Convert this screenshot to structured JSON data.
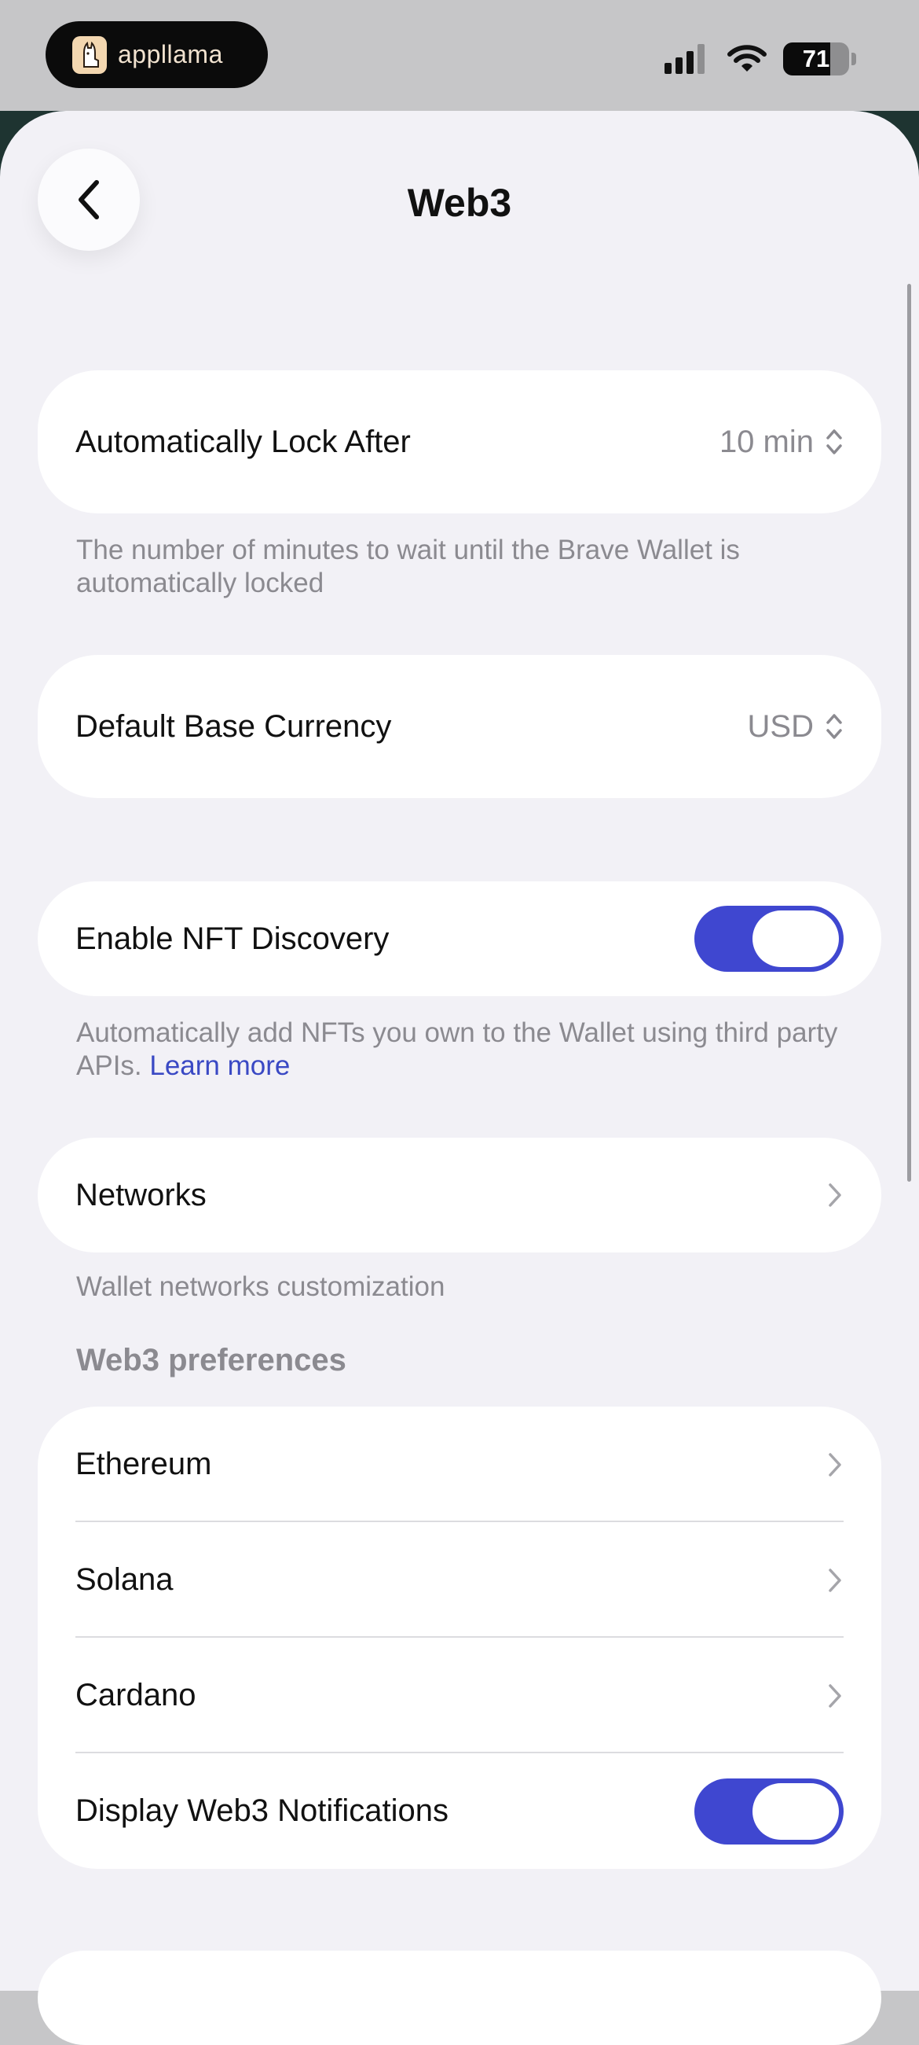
{
  "status_bar": {
    "app_name": "appllama",
    "battery_percent": "71",
    "battery_level": 0.71,
    "icons": [
      "signal-icon",
      "wifi-icon",
      "battery-icon"
    ]
  },
  "header": {
    "title": "Web3",
    "back_icon": "chevron-left-icon"
  },
  "auto_lock": {
    "label": "Automatically Lock After",
    "value": "10 min",
    "description": "The number of minutes to wait until the Brave Wallet is automatically locked"
  },
  "currency": {
    "label": "Default Base Currency",
    "value": "USD"
  },
  "nft": {
    "label": "Enable NFT Discovery",
    "enabled": true,
    "description": "Automatically add NFTs you own to the Wallet using third party APIs.",
    "link": "Learn more"
  },
  "networks": {
    "label": "Networks",
    "description": "Wallet networks customization"
  },
  "web3_prefs": {
    "header": "Web3 preferences",
    "items": [
      {
        "label": "Ethereum"
      },
      {
        "label": "Solana"
      },
      {
        "label": "Cardano"
      }
    ],
    "notifications": {
      "label": "Display Web3 Notifications",
      "enabled": true
    }
  },
  "colors": {
    "accent": "#3f47d0",
    "link": "#3a49c4",
    "background": "#f2f1f6",
    "backdrop": "#1e3431"
  }
}
